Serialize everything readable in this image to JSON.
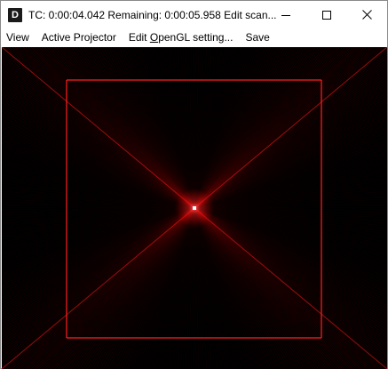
{
  "window": {
    "app_icon_letter": "D",
    "title": "TC: 0:00:04.042  Remaining: 0:00:05.958  Edit scan..."
  },
  "menu": {
    "items": [
      {
        "label": "View"
      },
      {
        "label": "Active Projector"
      },
      {
        "label_pre": "Edit ",
        "label_mnemonic": "O",
        "label_post": "penGL setting..."
      },
      {
        "label": "Save"
      }
    ]
  },
  "colors": {
    "beam": "#ff1a1a",
    "beam_dim": "#8b0000",
    "canvas_bg": "#000000",
    "hotspot": "#ffffff"
  },
  "icons": [
    "minimize-icon",
    "maximize-icon",
    "close-icon"
  ]
}
